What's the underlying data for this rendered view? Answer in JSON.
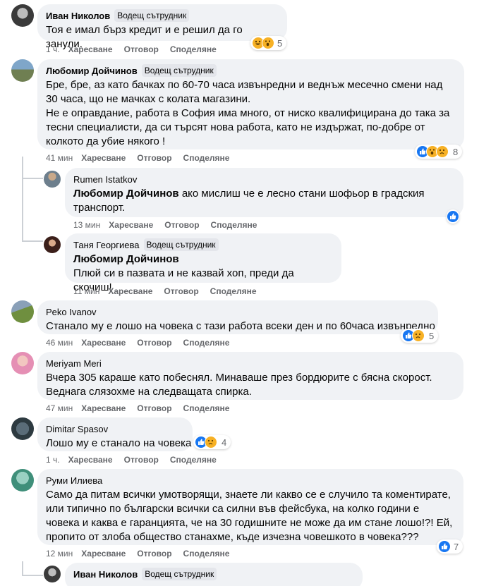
{
  "comments": [
    {
      "name": "Иван Николов",
      "badge": "Водещ сътрудник",
      "text": "Тоя е имал бърз кредит и е решил да го занули.",
      "time": "1 ч.",
      "reaction_count": "5"
    },
    {
      "name": "Любомир Дойчинов",
      "badge": "Водещ сътрудник",
      "text": "Бре, бре, аз като бачках по 60-70 часа извънредни и веднъж месечно смени над 30 часа, що не мачках с колата магазини.\nНе е оправдание, работа в София има много, от ниско квалифицирана до така за тесни специалисти, да си търсят нова работа, като не издържат, по-добре от колкото да убие някого !",
      "time": "41 мин",
      "reaction_count": "8"
    },
    {
      "name": "Rumen Istatkov",
      "mention": "Любомир Дойчинов",
      "text": "ако мислиш че е лесно стани шофьор в градския транспорт.",
      "time": "13 мин"
    },
    {
      "name": "Таня Георгиева",
      "badge": "Водещ сътрудник",
      "mention": "Любомир Дойчинов",
      "text": "Плюй си в пазвата и не казвай хоп, преди да скочиш!",
      "time": "11 мин"
    },
    {
      "name": "Peko Ivanov",
      "text": "Станало му е лошо на човека с тази работа всеки ден и по 60часа извънредно",
      "time": "46 мин",
      "reaction_count": "5"
    },
    {
      "name": "Meriyam Meri",
      "text": "Вчера 305 караше като побеснял. Минаваше през бордюрите с бясна скорост.\nВеднага слязохме на следващата спирка.",
      "time": "47 мин"
    },
    {
      "name": "Dimitar Spasov",
      "text": "Лошо му е станало на човека",
      "time": "1 ч.",
      "reaction_count": "4"
    },
    {
      "name": "Руми Илиева",
      "text": "Само да питам всички умотворящи, знаете ли какво се е случило та коментирате, или типично по български всички са силни във фейсбука, на колко години е човека и каква е гаранцията, че на 30 годишните не може да им стане лошо!?! Ей, пропито от злоба общество станахме, къде изчезна човешкото в човека???",
      "time": "12 мин",
      "reaction_count": "7"
    },
    {
      "name": "Иван Николов",
      "badge": "Водещ сътрудник"
    }
  ],
  "actions": {
    "like": "Харесване",
    "reply": "Отговор",
    "share": "Споделяне"
  },
  "colors": {
    "bubble": "#f0f2f5",
    "meta": "#65676b",
    "like": "#1877f2",
    "emoji": "#f7b125"
  }
}
